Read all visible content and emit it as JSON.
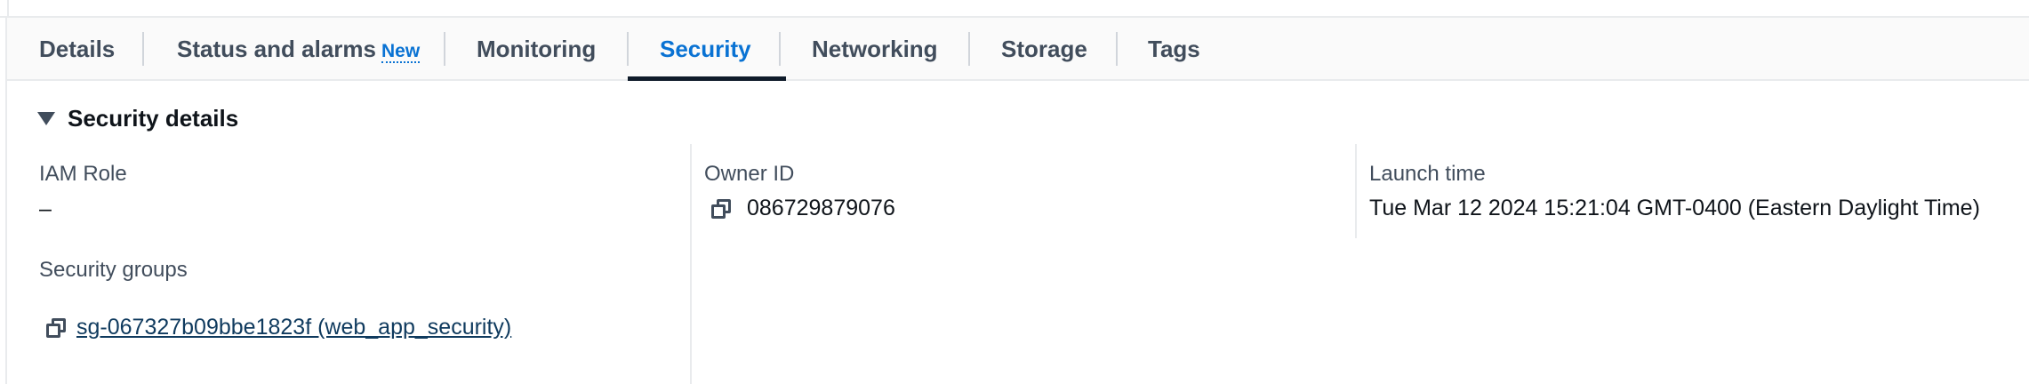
{
  "tabs": [
    {
      "label": "Details"
    },
    {
      "label": "Status and alarms",
      "badge": "New"
    },
    {
      "label": "Monitoring"
    },
    {
      "label": "Security"
    },
    {
      "label": "Networking"
    },
    {
      "label": "Storage"
    },
    {
      "label": "Tags"
    }
  ],
  "active_tab": "Security",
  "section": {
    "title": "Security details",
    "iam_role": {
      "label": "IAM Role",
      "value": "–"
    },
    "owner_id": {
      "label": "Owner ID",
      "value": "086729879076"
    },
    "launch_time": {
      "label": "Launch time",
      "value": "Tue Mar 12 2024 15:21:04 GMT-0400 (Eastern Daylight Time)"
    },
    "security_groups": {
      "label": "Security groups",
      "items": [
        "sg-067327b09bbe1823f (web_app_security)"
      ]
    }
  },
  "colors": {
    "accent": "#0972d3",
    "text": "#0f141a",
    "muted": "#414d5c",
    "link": "#0f3a5e"
  }
}
